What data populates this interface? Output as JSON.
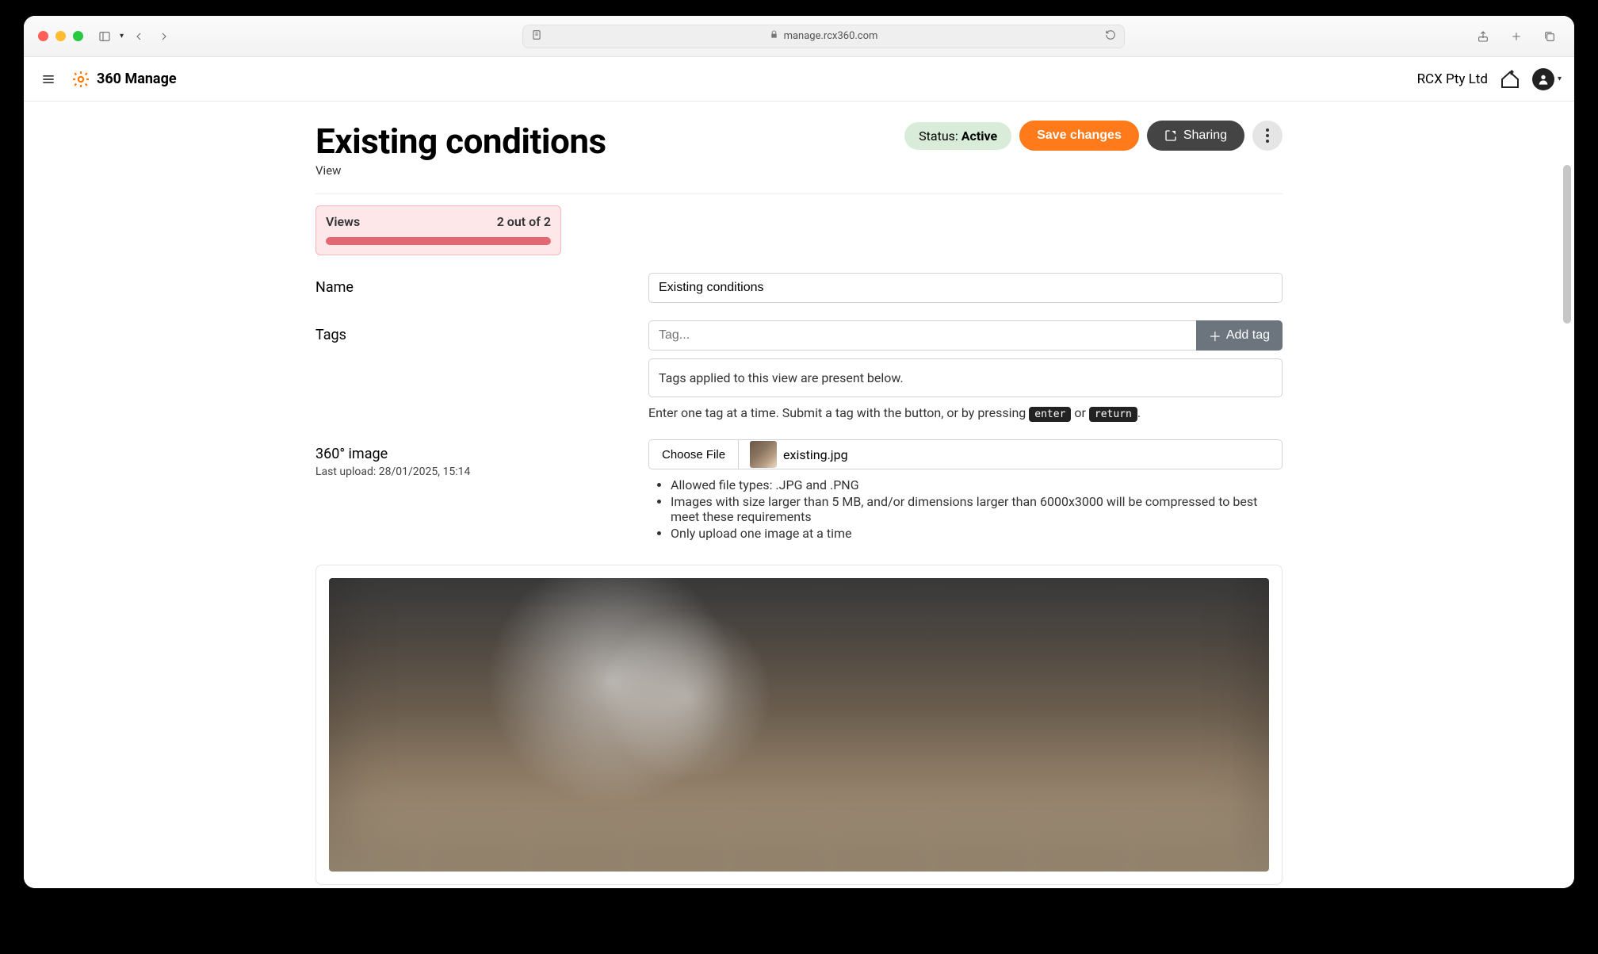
{
  "browser": {
    "url": "manage.rcx360.com"
  },
  "app": {
    "brand": "360 Manage",
    "org": "RCX Pty Ltd"
  },
  "page": {
    "title": "Existing conditions",
    "subtitle": "View",
    "status_label": "Status: ",
    "status_value": "Active",
    "save_button": "Save changes",
    "sharing_button": "Sharing"
  },
  "views_card": {
    "label": "Views",
    "count_text": "2 out of 2"
  },
  "form": {
    "name_label": "Name",
    "name_value": "Existing conditions",
    "tags_label": "Tags",
    "tags_placeholder": "Tag...",
    "add_tag_label": "Add tag",
    "tags_note": "Tags applied to this view are present below.",
    "tags_hint_pre": "Enter one tag at a time. Submit a tag with the button, or by pressing ",
    "kbd_enter": "enter",
    "kbd_or": " or ",
    "kbd_return": "return",
    "image_label": "360° image",
    "last_upload_label": "Last upload: ",
    "last_upload_value": "28/01/2025, 15:14",
    "choose_file_label": "Choose File",
    "file_name": "existing.jpg",
    "file_rule_1": "Allowed file types: .JPG and .PNG",
    "file_rule_2": "Images with size larger than 5 MB, and/or dimensions larger than 6000x3000 will be compressed to best meet these requirements",
    "file_rule_3": "Only upload one image at a time"
  }
}
